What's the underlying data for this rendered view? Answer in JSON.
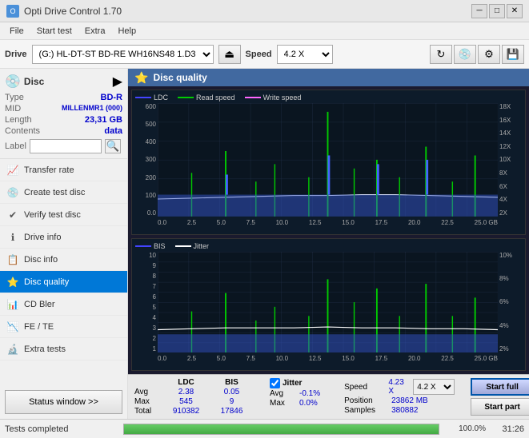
{
  "titleBar": {
    "title": "Opti Drive Control 1.70",
    "iconText": "O",
    "minBtn": "─",
    "maxBtn": "□",
    "closeBtn": "✕"
  },
  "menuBar": {
    "items": [
      "File",
      "Start test",
      "Extra",
      "Help"
    ]
  },
  "driveToolbar": {
    "driveLabel": "Drive",
    "driveValue": "(G:)  HL-DT-ST BD-RE  WH16NS48 1.D3",
    "speedLabel": "Speed",
    "speedValue": "4.2 X"
  },
  "disc": {
    "title": "Disc",
    "typeLabel": "Type",
    "typeValue": "BD-R",
    "midLabel": "MID",
    "midValue": "MILLENMR1 (000)",
    "lengthLabel": "Length",
    "lengthValue": "23,31 GB",
    "contentsLabel": "Contents",
    "contentsValue": "data",
    "labelLabel": "Label",
    "labelValue": ""
  },
  "sidebarNav": [
    {
      "id": "transfer-rate",
      "label": "Transfer rate",
      "icon": "📈"
    },
    {
      "id": "create-test-disc",
      "label": "Create test disc",
      "icon": "💿"
    },
    {
      "id": "verify-test-disc",
      "label": "Verify test disc",
      "icon": "✔"
    },
    {
      "id": "drive-info",
      "label": "Drive info",
      "icon": "ℹ"
    },
    {
      "id": "disc-info",
      "label": "Disc info",
      "icon": "📋"
    },
    {
      "id": "disc-quality",
      "label": "Disc quality",
      "icon": "⭐",
      "active": true
    },
    {
      "id": "cd-bler",
      "label": "CD Bler",
      "icon": "📊"
    },
    {
      "id": "fe-te",
      "label": "FE / TE",
      "icon": "📉"
    },
    {
      "id": "extra-tests",
      "label": "Extra tests",
      "icon": "🔬"
    }
  ],
  "statusWindowBtn": "Status window >>",
  "contentHeader": {
    "title": "Disc quality",
    "icon": "⭐"
  },
  "chart1": {
    "legend": [
      {
        "id": "ldc",
        "label": "LDC",
        "color": "#4444ff"
      },
      {
        "id": "read",
        "label": "Read speed",
        "color": "#00cc00"
      },
      {
        "id": "write",
        "label": "Write speed",
        "color": "#ff66ff"
      }
    ],
    "yAxisLeft": [
      "600",
      "500",
      "400",
      "300",
      "200",
      "100",
      "0.0"
    ],
    "yAxisRight": [
      "18X",
      "16X",
      "14X",
      "12X",
      "10X",
      "8X",
      "6X",
      "4X",
      "2X"
    ],
    "xAxis": [
      "0.0",
      "2.5",
      "5.0",
      "7.5",
      "10.0",
      "12.5",
      "15.0",
      "17.5",
      "20.0",
      "22.5",
      "25.0 GB"
    ]
  },
  "chart2": {
    "legend": [
      {
        "id": "bis",
        "label": "BIS",
        "color": "#4444ff"
      },
      {
        "id": "jitter",
        "label": "Jitter",
        "color": "#ffffff"
      }
    ],
    "yAxisLeft": [
      "10",
      "9",
      "8",
      "7",
      "6",
      "5",
      "4",
      "3",
      "2",
      "1"
    ],
    "yAxisRight": [
      "10%",
      "8%",
      "6%",
      "4%",
      "2%"
    ],
    "xAxis": [
      "0.0",
      "2.5",
      "5.0",
      "7.5",
      "10.0",
      "12.5",
      "15.0",
      "17.5",
      "20.0",
      "22.5",
      "25.0 GB"
    ]
  },
  "stats": {
    "ldcLabel": "LDC",
    "bisLabel": "BIS",
    "jitterLabel": "Jitter",
    "avgLabel": "Avg",
    "maxLabel": "Max",
    "totalLabel": "Total",
    "ldcAvg": "2.38",
    "ldcMax": "545",
    "ldcTotal": "910382",
    "bisAvg": "0.05",
    "bisMax": "9",
    "bisTotal": "17846",
    "jitterAvgLabel": "-0.1%",
    "jitterMaxLabel": "0.0%",
    "jitterTotalLabel": "",
    "speedLabel": "Speed",
    "speedValue": "4.23 X",
    "speedSelectValue": "4.2 X",
    "positionLabel": "Position",
    "positionValue": "23862 MB",
    "samplesLabel": "Samples",
    "samplesValue": "380882",
    "startFullBtn": "Start full",
    "startPartBtn": "Start part",
    "jitterCheckbox": "Jitter"
  },
  "statusBar": {
    "statusText": "Tests completed",
    "progressPercent": "100.0%",
    "timeText": "31:26",
    "progressValue": 100
  }
}
